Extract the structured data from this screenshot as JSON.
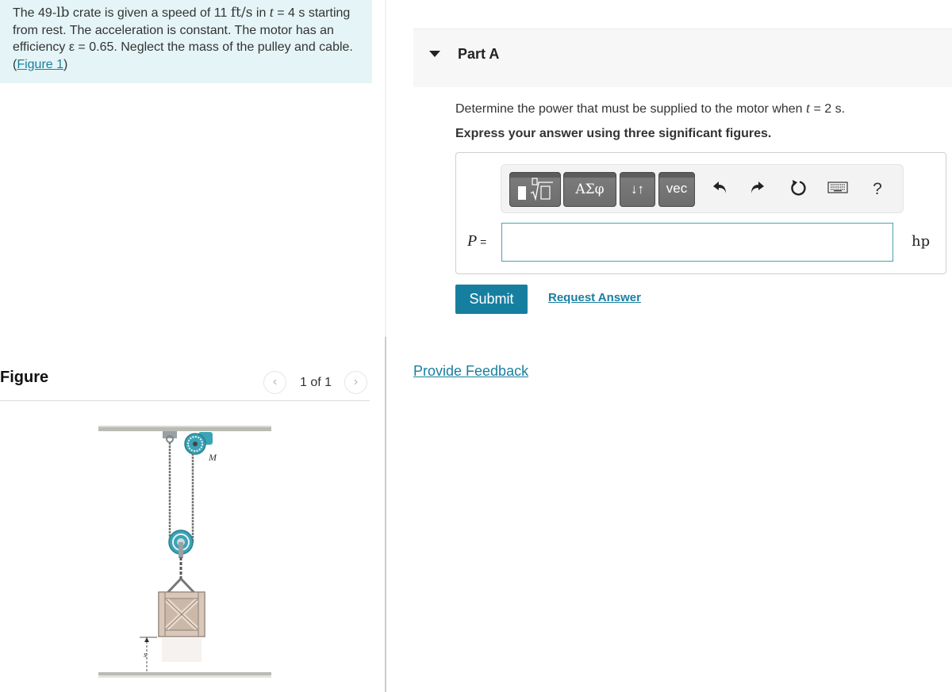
{
  "problem": {
    "segments": [
      {
        "t": "The 49-",
        "style": "text"
      },
      {
        "t": "lb",
        "style": "serif"
      },
      {
        "t": " crate is given a speed of 11  ",
        "style": "text"
      },
      {
        "t": "ft/s",
        "style": "serif"
      },
      {
        "t": " in ",
        "style": "text"
      },
      {
        "t": "t",
        "style": "ital"
      },
      {
        "t": " = 4 s starting from rest. The acceleration is constant. The motor has an efficiency ε = 0.65. Neglect the mass of the pulley and cable. (",
        "style": "text"
      }
    ],
    "figure_link": "Figure 1",
    "close_paren": ")"
  },
  "figure": {
    "title": "Figure",
    "pager": "1 of 1",
    "prev_icon": "chevron-left-icon",
    "next_icon": "chevron-right-icon",
    "motor_label": "M",
    "distance_label": "s"
  },
  "part": {
    "title": "Part A",
    "question_before": "Determine the power that must be supplied to the motor when ",
    "question_var": "t",
    "question_after": " = 2 s.",
    "instruction": "Express your answer using three significant figures."
  },
  "toolbar": {
    "greek": "ΑΣφ",
    "arrows": "↓↑",
    "vec": "vec",
    "undo": "↶",
    "redo": "↷",
    "reset": "↻",
    "help": "?"
  },
  "answer": {
    "variable": "P",
    "equals": " =",
    "value": "",
    "unit": "hp"
  },
  "actions": {
    "submit": "Submit",
    "request": "Request Answer",
    "feedback": "Provide Feedback"
  },
  "colors": {
    "accent": "#167fa0",
    "problem_bg": "#e5f5f7",
    "link": "#1a7fa0"
  }
}
